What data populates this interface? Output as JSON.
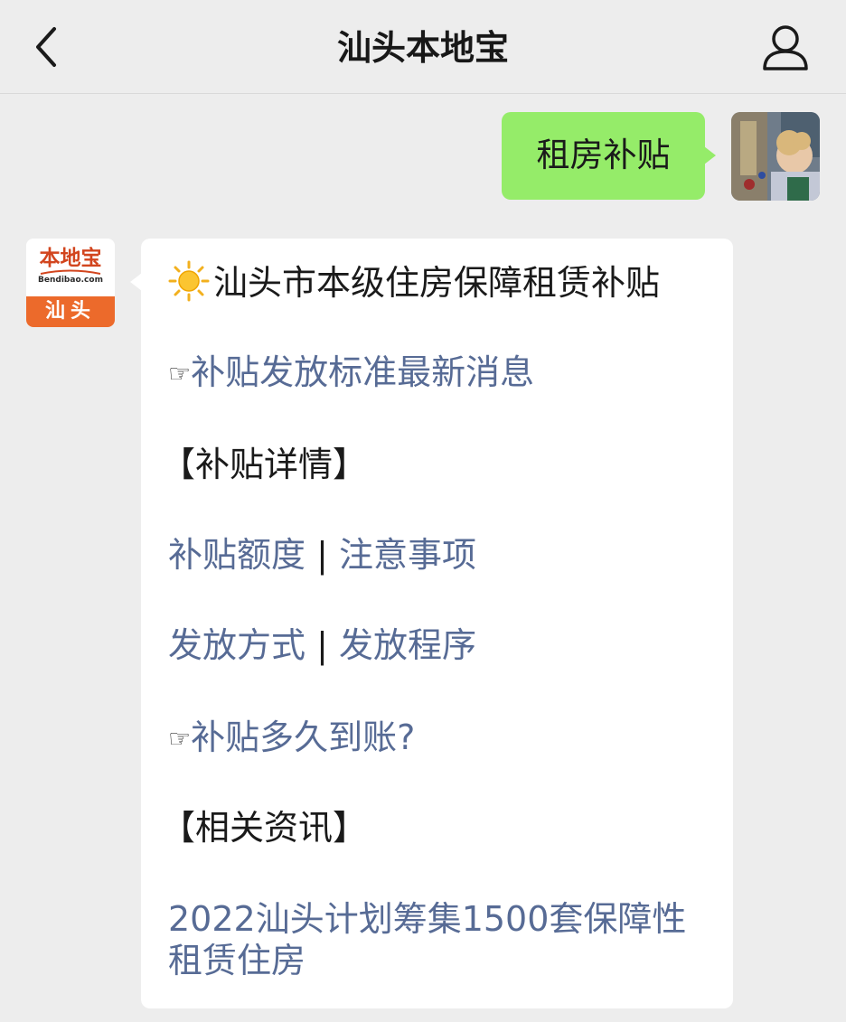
{
  "header": {
    "title": "汕头本地宝",
    "back_icon": "chevron-left-icon",
    "profile_icon": "person-icon"
  },
  "user_message": {
    "text": "租房补贴",
    "bubble_color": "#95ec69"
  },
  "bot": {
    "avatar": {
      "logo_text": "本地宝",
      "logo_url": "Bendibao.com",
      "city": "汕头",
      "brand_color": "#ec6a2b"
    },
    "message": {
      "heading": "汕头市本级住房保障租赁补贴",
      "heading_icon": "sun-icon",
      "link1": "补贴发放标准最新消息",
      "link1_icon": "pointing-hand-icon",
      "section1": "【补贴详情】",
      "row1_a": "补贴额度",
      "row1_sep": "|",
      "row1_b": "注意事项",
      "row2_a": "发放方式",
      "row2_sep": "|",
      "row2_b": "发放程序",
      "link2": "补贴多久到账?",
      "link2_icon": "pointing-hand-icon",
      "section2": "【相关资讯】",
      "news": "2022汕头计划筹集1500套保障性租赁住房",
      "link_color": "#576b95"
    }
  }
}
